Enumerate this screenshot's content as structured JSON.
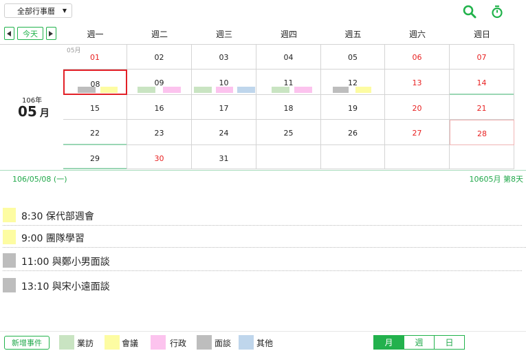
{
  "toolbar": {
    "filter_value": "全部行事曆",
    "filter_caret": "▼"
  },
  "nav": {
    "today_label": "今天"
  },
  "weekdays": [
    "週一",
    "週二",
    "週三",
    "週四",
    "週五",
    "週六",
    "週日"
  ],
  "month_side": {
    "year": "106年",
    "month": "05",
    "month_suffix": "月"
  },
  "first_cell_month_label": "05月",
  "weeks": [
    [
      "01",
      "02",
      "03",
      "04",
      "05",
      "06",
      "07"
    ],
    [
      "08",
      "09",
      "10",
      "11",
      "12",
      "13",
      "14"
    ],
    [
      "15",
      "16",
      "17",
      "18",
      "19",
      "20",
      "21"
    ],
    [
      "22",
      "23",
      "24",
      "25",
      "26",
      "27",
      "28"
    ],
    [
      "29",
      "30",
      "31",
      "",
      "",
      "",
      ""
    ]
  ],
  "red_days": [
    "01",
    "06",
    "07",
    "13",
    "14",
    "20",
    "21",
    "27",
    "28",
    "30"
  ],
  "colors": {
    "visit": "#c9e4c2",
    "meeting": "#fdfca2",
    "admin": "#fcc3ee",
    "interview": "#bdbdbd",
    "other": "#bfd6ec",
    "accent": "#20b24a",
    "today_border": "#e21f26"
  },
  "status": {
    "selected_date": "106/05/08 (一)",
    "summary": "10605月 第8天"
  },
  "events": [
    {
      "time_title": "8:30  保代部週會",
      "category": "meeting"
    },
    {
      "time_title": "9:00  團隊學習",
      "category": "meeting"
    },
    {
      "time_title": "11:00 與鄭小男面談",
      "category": "interview"
    },
    {
      "time_title": "13:10 與宋小遠面談",
      "category": "interview"
    }
  ],
  "footer": {
    "add_label": "新增事件",
    "legend": [
      {
        "label": "業訪",
        "category": "visit"
      },
      {
        "label": "會議",
        "category": "meeting"
      },
      {
        "label": "行政",
        "category": "admin"
      },
      {
        "label": "面談",
        "category": "interview"
      },
      {
        "label": "其他",
        "category": "other"
      }
    ],
    "views": [
      "月",
      "週",
      "日"
    ],
    "active_view": "月"
  },
  "icons": {
    "search": "search-icon",
    "timer": "stopwatch-icon",
    "prev": "chevron-left-icon",
    "next": "chevron-right-icon"
  }
}
